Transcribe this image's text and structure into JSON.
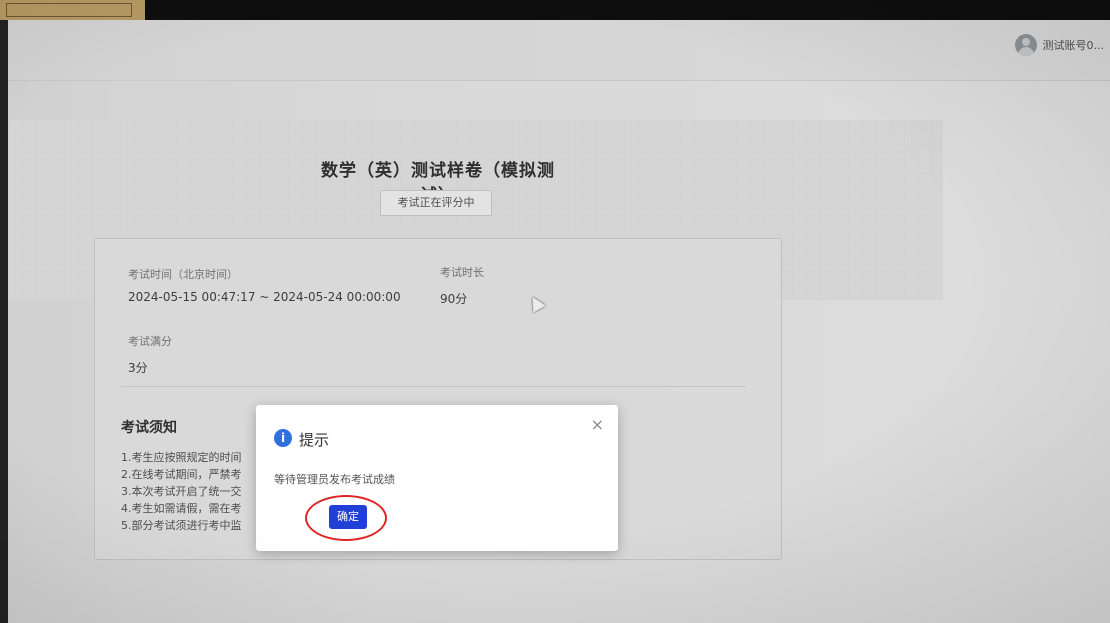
{
  "header": {
    "username": "测试账号0..."
  },
  "exam": {
    "title": "数学（英）测试样卷（模拟测试）",
    "status_label": "考试正在评分中",
    "time_label": "考试时间（北京时间）",
    "time_value": "2024-05-15 00:47:17 ~ 2024-05-24 00:00:00",
    "duration_label": "考试时长",
    "duration_value": "90分",
    "full_score_label": "考试满分",
    "full_score_value": "3分"
  },
  "notice": {
    "title": "考试须知",
    "items": [
      "1.考生应按照规定的时间",
      "2.在线考试期间，严禁考",
      "3.本次考试开启了统一交",
      "4.考生如需请假，需在考",
      "5.部分考试须进行考中监"
    ]
  },
  "modal": {
    "icon": "info-icon",
    "title": "提示",
    "message": "等待管理员发布考试成绩",
    "close_symbol": "×",
    "confirm_label": "确定"
  },
  "colors": {
    "primary_button": "#1f3fd6",
    "info_icon": "#2f6fe0",
    "highlight_circle": "#e02424"
  }
}
